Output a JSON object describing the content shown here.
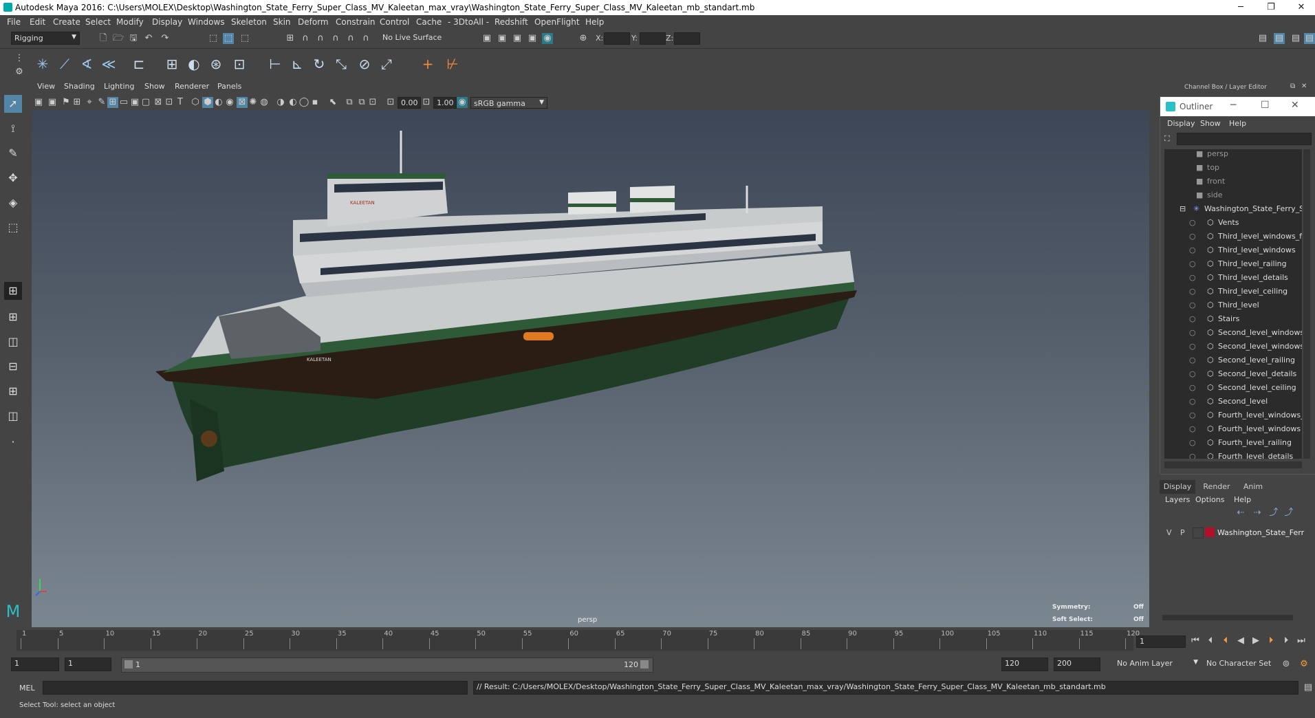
{
  "window": {
    "title": "Autodesk Maya 2016: C:\\Users\\MOLEX\\Desktop\\Washington_State_Ferry_Super_Class_MV_Kaleetan_max_vray\\Washington_State_Ferry_Super_Class_MV_Kaleetan_mb_standart.mb",
    "minimize": "─",
    "restore": "❐",
    "close": "✕"
  },
  "menubar": [
    "File",
    "Edit",
    "Create",
    "Select",
    "Modify",
    "Display",
    "Windows",
    "Skeleton",
    "Skin",
    "Deform",
    "Constrain",
    "Control",
    "Cache",
    "- 3DtoAll -",
    "Redshift",
    "OpenFlight",
    "Help"
  ],
  "statusline": {
    "mode": "Rigging",
    "live_surface": "No Live Surface",
    "x_label": "X:",
    "y_label": "Y:",
    "z_label": "Z:"
  },
  "panel_menu": [
    "View",
    "Shading",
    "Lighting",
    "Show",
    "Renderer",
    "Panels"
  ],
  "panel_tools": {
    "exposure": "0.00",
    "gamma": "1.00",
    "color_space": "sRGB gamma"
  },
  "viewport": {
    "camera_label": "persp",
    "symmetry_label": "Symmetry:",
    "symmetry_value": "Off",
    "soft_select_label": "Soft Select:",
    "soft_select_value": "Off",
    "ship_name_bow": "KALEETAN",
    "ship_name_upper": "KALEETAN"
  },
  "channel_box_header": "Channel Box / Layer Editor",
  "outliner": {
    "title": "Outliner",
    "menu": [
      "Display",
      "Show",
      "Help"
    ],
    "items": [
      {
        "label": "persp",
        "kind": "camera"
      },
      {
        "label": "top",
        "kind": "camera"
      },
      {
        "label": "front",
        "kind": "camera"
      },
      {
        "label": "side",
        "kind": "camera"
      },
      {
        "label": "Washington_State_Ferry_Su",
        "kind": "group"
      },
      {
        "label": "Vents",
        "kind": "mesh"
      },
      {
        "label": "Third_level_windows_fr",
        "kind": "mesh"
      },
      {
        "label": "Third_level_windows",
        "kind": "mesh"
      },
      {
        "label": "Third_level_railing",
        "kind": "mesh"
      },
      {
        "label": "Third_level_details",
        "kind": "mesh"
      },
      {
        "label": "Third_level_ceiling",
        "kind": "mesh"
      },
      {
        "label": "Third_level",
        "kind": "mesh"
      },
      {
        "label": "Stairs",
        "kind": "mesh"
      },
      {
        "label": "Second_level_windows",
        "kind": "mesh"
      },
      {
        "label": "Second_level_windows",
        "kind": "mesh"
      },
      {
        "label": "Second_level_railing",
        "kind": "mesh"
      },
      {
        "label": "Second_level_details",
        "kind": "mesh"
      },
      {
        "label": "Second_level_ceiling",
        "kind": "mesh"
      },
      {
        "label": "Second_level",
        "kind": "mesh"
      },
      {
        "label": "Fourth_level_windows_",
        "kind": "mesh"
      },
      {
        "label": "Fourth_level_windows",
        "kind": "mesh"
      },
      {
        "label": "Fourth_level_railing",
        "kind": "mesh"
      },
      {
        "label": "Fourth_level_details",
        "kind": "mesh"
      }
    ]
  },
  "layer_editor": {
    "tabs": [
      "Display",
      "Render",
      "Anim"
    ],
    "menu": [
      "Layers",
      "Options",
      "Help"
    ],
    "layer": {
      "v": "V",
      "p": "P",
      "name": "Washington_State_Ferr",
      "color": "#b0102a"
    }
  },
  "timeline": {
    "ticks": [
      "1",
      "5",
      "10",
      "15",
      "20",
      "25",
      "30",
      "35",
      "40",
      "45",
      "50",
      "55",
      "60",
      "65",
      "70",
      "75",
      "80",
      "85",
      "90",
      "95",
      "100",
      "105",
      "110",
      "115",
      "120"
    ],
    "current_frame": "1"
  },
  "range": {
    "start": "1",
    "playback_start": "1",
    "slider_start": "1",
    "slider_end": "120",
    "playback_end": "120",
    "end": "200",
    "anim_layer": "No Anim Layer",
    "character_set": "No Character Set"
  },
  "cmdline": {
    "label": "MEL",
    "result": "// Result: C:/Users/MOLEX/Desktop/Washington_State_Ferry_Super_Class_MV_Kaleetan_max_vray/Washington_State_Ferry_Super_Class_MV_Kaleetan_mb_standart.mb"
  },
  "helpline": "Select Tool: select an object"
}
